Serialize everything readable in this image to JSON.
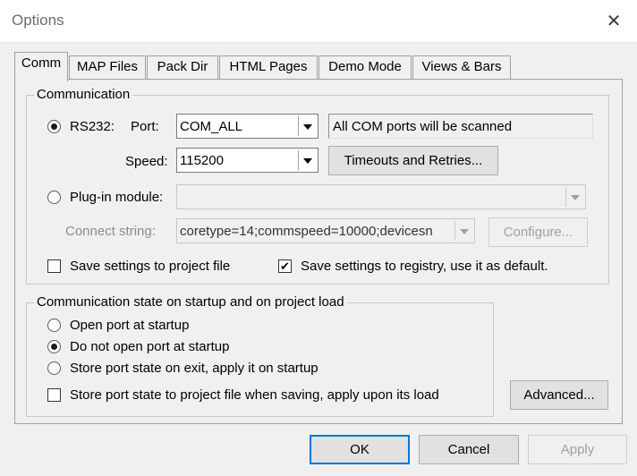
{
  "window": {
    "title": "Options",
    "close_glyph": "✕"
  },
  "tabs": [
    "Comm",
    "MAP Files",
    "Pack Dir",
    "HTML Pages",
    "Demo Mode",
    "Views & Bars"
  ],
  "communication": {
    "group_label": "Communication",
    "rs232_label": "RS232:",
    "port_label": "Port:",
    "port_value": "COM_ALL",
    "port_info": "All COM ports will be scanned",
    "speed_label": "Speed:",
    "speed_value": "115200",
    "timeouts_button": "Timeouts and Retries...",
    "plugin_label": "Plug-in module:",
    "plugin_value": "",
    "connect_string_label": "Connect string:",
    "connect_string_value": "coretype=14;commspeed=10000;devicesn",
    "configure_button": "Configure...",
    "save_project_label": "Save settings to project file",
    "save_project_checked": false,
    "save_registry_label": "Save settings to registry, use it as default.",
    "save_registry_checked": true,
    "selected_mode": "rs232"
  },
  "startup": {
    "group_label": "Communication state on startup and on project load",
    "open_port_label": "Open port at startup",
    "do_not_open_label": "Do not open port at startup",
    "store_state_label": "Store port state on exit, apply it on startup",
    "store_project_label": "Store port state to project file when saving, apply upon its load",
    "store_project_checked": false,
    "selected": "do_not_open"
  },
  "buttons": {
    "advanced": "Advanced...",
    "ok": "OK",
    "cancel": "Cancel",
    "apply": "Apply"
  },
  "check_glyph": "✔"
}
